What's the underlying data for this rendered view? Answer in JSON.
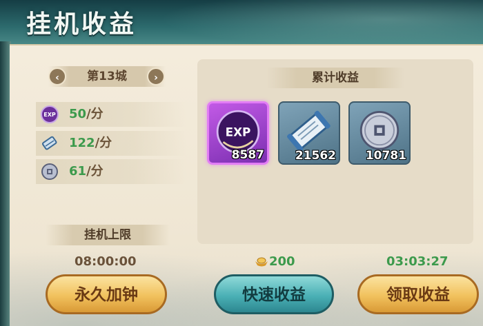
{
  "window": {
    "title": "挂机收益"
  },
  "city_selector": {
    "prev_label": "‹",
    "name": "第13城",
    "next_label": "›"
  },
  "rates": [
    {
      "icon": "exp-orb-icon",
      "value": "50",
      "unit": "/分"
    },
    {
      "icon": "scroll-icon",
      "value": "122",
      "unit": "/分"
    },
    {
      "icon": "coin-icon",
      "value": "61",
      "unit": "/分"
    }
  ],
  "idle_limit": {
    "label": "挂机上限",
    "time": "08:00:00"
  },
  "rewards": {
    "label": "累计收益",
    "items": [
      {
        "icon": "exp-orb-icon",
        "badge": "EXP",
        "count": "8587"
      },
      {
        "icon": "scroll-icon",
        "count": "21562"
      },
      {
        "icon": "coin-icon",
        "count": "10781"
      }
    ]
  },
  "quick_claim": {
    "cost": "200",
    "label": "快速收益"
  },
  "claim": {
    "timer": "03:03:27",
    "label": "领取收益"
  },
  "extend": {
    "label": "永久加钟"
  },
  "colors": {
    "accent_green": "#3c9a4c",
    "gold_button": "#f1c15d",
    "teal_button": "#4ab0b5",
    "exp_purple": "#9b44d0"
  }
}
